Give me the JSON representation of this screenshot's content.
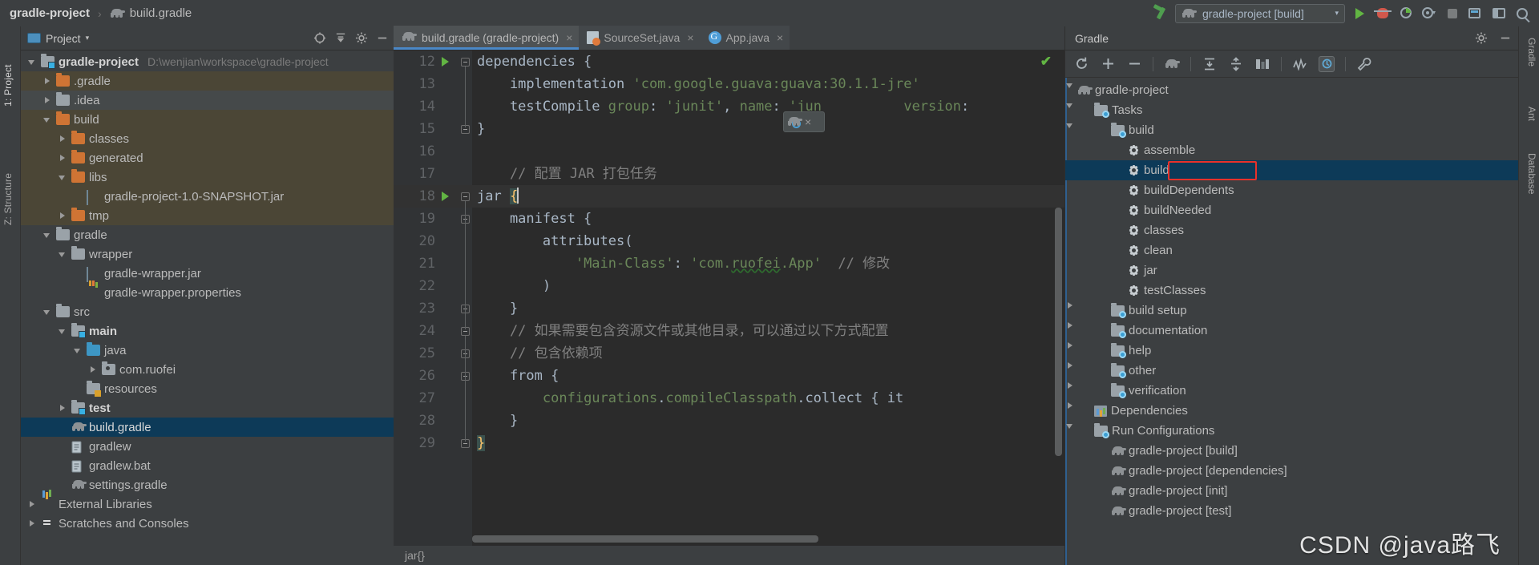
{
  "topbar": {
    "project_name": "gradle-project",
    "separator": "›",
    "file_name": "build.gradle",
    "elephant_icon": "gradle-elephant-icon",
    "hammer_icon": "build-hammer-icon",
    "run_config": {
      "label": "gradle-project [build]",
      "chevron": "▾"
    },
    "actions": [
      {
        "name": "run-button",
        "glyph": "run-triangle-icon"
      },
      {
        "name": "debug-button",
        "glyph": "debug-bug-icon"
      },
      {
        "name": "run-with-coverage-button",
        "glyph": "coverage-icon"
      },
      {
        "name": "profiler-button",
        "glyph": "profiler-icon"
      },
      {
        "name": "stop-button",
        "glyph": "stop-square-icon"
      },
      {
        "name": "update-button",
        "glyph": "update-icon"
      },
      {
        "name": "layout-button",
        "glyph": "layout-icon"
      },
      {
        "name": "search-everywhere-button",
        "glyph": "search-icon"
      }
    ]
  },
  "left_strip": {
    "tabs": [
      {
        "label": "1: Project",
        "selected": true
      },
      {
        "label": "Z: Structure",
        "selected": false
      },
      {
        "label": "",
        "selected": false
      }
    ]
  },
  "right_strip": {
    "tabs": [
      {
        "label": "Gradle"
      },
      {
        "label": "Ant"
      },
      {
        "label": "Database"
      }
    ]
  },
  "project_pane": {
    "title": "Project",
    "caret": "▾",
    "toolbar_icons": [
      "locate-icon",
      "collapse-all-icon",
      "settings-gear-icon",
      "hide-icon"
    ],
    "tree": [
      {
        "depth": 0,
        "arrow": "down",
        "icon": "module-folder",
        "label": "gradle-project",
        "bold": true,
        "path": "D:\\wenjian\\workspace\\gradle-project",
        "row": "normal"
      },
      {
        "depth": 1,
        "arrow": "right",
        "icon": "folder-orange",
        "label": ".gradle",
        "bold": false,
        "path": "",
        "row": "tan"
      },
      {
        "depth": 1,
        "arrow": "right",
        "icon": "folder-gray",
        "label": ".idea",
        "bold": false,
        "path": "",
        "row": "gray"
      },
      {
        "depth": 1,
        "arrow": "down",
        "icon": "folder-orange",
        "label": "build",
        "bold": false,
        "path": "",
        "row": "tan"
      },
      {
        "depth": 2,
        "arrow": "right",
        "icon": "folder-orange",
        "label": "classes",
        "bold": false,
        "path": "",
        "row": "tan"
      },
      {
        "depth": 2,
        "arrow": "right",
        "icon": "folder-orange",
        "label": "generated",
        "bold": false,
        "path": "",
        "row": "tan"
      },
      {
        "depth": 2,
        "arrow": "down",
        "icon": "folder-orange",
        "label": "libs",
        "bold": false,
        "path": "",
        "row": "tan"
      },
      {
        "depth": 3,
        "arrow": "none",
        "icon": "jar-file",
        "label": "gradle-project-1.0-SNAPSHOT.jar",
        "bold": false,
        "path": "",
        "row": "tan"
      },
      {
        "depth": 2,
        "arrow": "right",
        "icon": "folder-orange",
        "label": "tmp",
        "bold": false,
        "path": "",
        "row": "tan"
      },
      {
        "depth": 1,
        "arrow": "down",
        "icon": "folder-gray",
        "label": "gradle",
        "bold": false,
        "path": "",
        "row": "normal"
      },
      {
        "depth": 2,
        "arrow": "down",
        "icon": "folder-gray",
        "label": "wrapper",
        "bold": false,
        "path": "",
        "row": "normal"
      },
      {
        "depth": 3,
        "arrow": "none",
        "icon": "jar-file",
        "label": "gradle-wrapper.jar",
        "bold": false,
        "path": "",
        "row": "normal"
      },
      {
        "depth": 3,
        "arrow": "none",
        "icon": "properties-file",
        "label": "gradle-wrapper.properties",
        "bold": false,
        "path": "",
        "row": "normal"
      },
      {
        "depth": 1,
        "arrow": "down",
        "icon": "folder-gray",
        "label": "src",
        "bold": false,
        "path": "",
        "row": "normal"
      },
      {
        "depth": 2,
        "arrow": "down",
        "icon": "folder-source-root",
        "label": "main",
        "bold": true,
        "path": "",
        "row": "normal"
      },
      {
        "depth": 3,
        "arrow": "down",
        "icon": "folder-blue",
        "label": "java",
        "bold": false,
        "path": "",
        "row": "normal"
      },
      {
        "depth": 4,
        "arrow": "right",
        "icon": "package-icon",
        "label": "com.ruofei",
        "bold": false,
        "path": "",
        "row": "normal"
      },
      {
        "depth": 3,
        "arrow": "none",
        "icon": "folder-resources",
        "label": "resources",
        "bold": false,
        "path": "",
        "row": "normal"
      },
      {
        "depth": 2,
        "arrow": "right",
        "icon": "folder-test-root",
        "label": "test",
        "bold": true,
        "path": "",
        "row": "normal"
      },
      {
        "depth": 2,
        "arrow": "none",
        "icon": "gradle-file",
        "label": "build.gradle",
        "bold": false,
        "path": "",
        "row": "selected"
      },
      {
        "depth": 2,
        "arrow": "none",
        "icon": "text-file",
        "label": "gradlew",
        "bold": false,
        "path": "",
        "row": "normal"
      },
      {
        "depth": 2,
        "arrow": "none",
        "icon": "text-file",
        "label": "gradlew.bat",
        "bold": false,
        "path": "",
        "row": "normal"
      },
      {
        "depth": 2,
        "arrow": "none",
        "icon": "gradle-file",
        "label": "settings.gradle",
        "bold": false,
        "path": "",
        "row": "normal"
      },
      {
        "depth": 0,
        "arrow": "right",
        "icon": "library-icon",
        "label": "External Libraries",
        "bold": false,
        "path": "",
        "row": "normal"
      },
      {
        "depth": 0,
        "arrow": "right",
        "icon": "scratch-icon",
        "label": "Scratches and Consoles",
        "bold": false,
        "path": "",
        "row": "normal"
      }
    ]
  },
  "editor": {
    "tabs": [
      {
        "label": "build.gradle (gradle-project)",
        "icon": "gradle-elephant-icon",
        "active": true,
        "close": "×"
      },
      {
        "label": "SourceSet.java",
        "icon": "java-class-icon",
        "active": false,
        "close": "×"
      },
      {
        "label": "App.java",
        "icon": "groovy-icon",
        "active": false,
        "close": "×"
      }
    ],
    "inspection_status": "✔",
    "floating_widget": {
      "name": "gradle-reimport-widget",
      "close": "×"
    },
    "breadcrumb": "jar{}",
    "lines": [
      {
        "num": "12",
        "run_marker": true,
        "fold": "open",
        "indent": 0,
        "tokens": [
          {
            "t": "dependencies {",
            "c": "fn"
          }
        ]
      },
      {
        "num": "13",
        "run_marker": false,
        "fold": "none",
        "indent": 0,
        "tokens": [
          {
            "t": "    implementation ",
            "c": "fn"
          },
          {
            "t": "'com.google.guava:guava:30.1.1-jre'",
            "c": "str"
          }
        ]
      },
      {
        "num": "14",
        "run_marker": false,
        "fold": "none",
        "indent": 0,
        "tokens": [
          {
            "t": "    testCompile ",
            "c": "fn"
          },
          {
            "t": "group",
            "c": "str"
          },
          {
            "t": ": ",
            "c": "fn"
          },
          {
            "t": "'junit'",
            "c": "str"
          },
          {
            "t": ", ",
            "c": "fn"
          },
          {
            "t": "name",
            "c": "str"
          },
          {
            "t": ": ",
            "c": "fn"
          },
          {
            "t": "'jun",
            "c": "str"
          },
          {
            "t": "          ",
            "c": "fn"
          },
          {
            "t": "version",
            "c": "str"
          },
          {
            "t": ":",
            "c": "fn"
          }
        ]
      },
      {
        "num": "15",
        "run_marker": false,
        "fold": "close",
        "indent": 0,
        "tokens": [
          {
            "t": "}",
            "c": "fn"
          }
        ]
      },
      {
        "num": "16",
        "run_marker": false,
        "fold": "none",
        "indent": 0,
        "tokens": []
      },
      {
        "num": "17",
        "run_marker": false,
        "fold": "none",
        "indent": 0,
        "tokens": [
          {
            "t": "    // 配置 JAR 打包任务",
            "c": "cmt"
          }
        ]
      },
      {
        "num": "18",
        "run_marker": true,
        "fold": "open",
        "indent": 0,
        "tokens": [
          {
            "t": "jar ",
            "c": "fn"
          },
          {
            "t": "{",
            "c": "brace"
          },
          {
            "t": "|",
            "c": "caret"
          }
        ]
      },
      {
        "num": "19",
        "run_marker": false,
        "fold": "open",
        "indent": 0,
        "tokens": [
          {
            "t": "    manifest {",
            "c": "fn"
          }
        ]
      },
      {
        "num": "20",
        "run_marker": false,
        "fold": "none",
        "indent": 0,
        "tokens": [
          {
            "t": "        attributes(",
            "c": "fn"
          }
        ]
      },
      {
        "num": "21",
        "run_marker": false,
        "fold": "none",
        "indent": 0,
        "tokens": [
          {
            "t": "            ",
            "c": "fn"
          },
          {
            "t": "'Main-Class'",
            "c": "str"
          },
          {
            "t": ": ",
            "c": "fn"
          },
          {
            "t": "'com.",
            "c": "str"
          },
          {
            "t": "ruofei",
            "c": "str-wavy"
          },
          {
            "t": ".App'",
            "c": "str"
          },
          {
            "t": "  // 修改",
            "c": "cmt"
          }
        ]
      },
      {
        "num": "22",
        "run_marker": false,
        "fold": "none",
        "indent": 0,
        "tokens": [
          {
            "t": "        )",
            "c": "fn"
          }
        ]
      },
      {
        "num": "23",
        "run_marker": false,
        "fold": "close",
        "indent": 0,
        "tokens": [
          {
            "t": "    }",
            "c": "fn"
          }
        ]
      },
      {
        "num": "24",
        "run_marker": false,
        "fold": "close",
        "indent": 0,
        "tokens": [
          {
            "t": "    // 如果需要包含资源文件或其他目录，可以通过以下方式配置",
            "c": "cmt"
          }
        ]
      },
      {
        "num": "25",
        "run_marker": false,
        "fold": "close",
        "indent": 0,
        "tokens": [
          {
            "t": "    // 包含依赖项",
            "c": "cmt"
          }
        ]
      },
      {
        "num": "26",
        "run_marker": false,
        "fold": "close",
        "indent": 0,
        "tokens": [
          {
            "t": "    from {",
            "c": "fn"
          }
        ]
      },
      {
        "num": "27",
        "run_marker": false,
        "fold": "none",
        "indent": 0,
        "tokens": [
          {
            "t": "        ",
            "c": "fn"
          },
          {
            "t": "configurations",
            "c": "str"
          },
          {
            "t": ".",
            "c": "fn"
          },
          {
            "t": "compileClasspath",
            "c": "str"
          },
          {
            "t": ".collect { it",
            "c": "fn"
          }
        ]
      },
      {
        "num": "28",
        "run_marker": false,
        "fold": "none",
        "indent": 0,
        "tokens": [
          {
            "t": "    }",
            "c": "fn"
          }
        ]
      },
      {
        "num": "29",
        "run_marker": false,
        "fold": "close",
        "indent": 0,
        "tokens": [
          {
            "t": "}",
            "c": "brace"
          }
        ]
      }
    ]
  },
  "gradle_pane": {
    "title": "Gradle",
    "header_icons": [
      "settings-gear-icon",
      "hide-icon"
    ],
    "toolbar": [
      {
        "name": "refresh-all-button",
        "glyph": "refresh-icon"
      },
      {
        "name": "link-gradle-project-button",
        "glyph": "plus-icon"
      },
      {
        "name": "detach-project-button",
        "glyph": "minus-icon"
      },
      {
        "name": "execute-gradle-task-button",
        "glyph": "gradle-elephant-icon"
      },
      {
        "name": "expand-all-button",
        "glyph": "expand-all-icon"
      },
      {
        "name": "collapse-all-button",
        "glyph": "collapse-all-icon"
      },
      {
        "name": "group-tasks-button",
        "glyph": "group-modules-icon"
      },
      {
        "name": "toggle-offline-button",
        "glyph": "offline-icon"
      },
      {
        "name": "show-task-list-button",
        "glyph": "task-list-icon"
      },
      {
        "name": "build-tool-settings-button",
        "glyph": "wrench-icon"
      }
    ],
    "tree": [
      {
        "depth": 0,
        "arrow": "down",
        "icon": "gradle-elephant-icon",
        "label": "gradle-project",
        "selected": false
      },
      {
        "depth": 1,
        "arrow": "down",
        "icon": "task-folder-icon",
        "label": "Tasks",
        "selected": false
      },
      {
        "depth": 2,
        "arrow": "down",
        "icon": "task-folder-icon",
        "label": "build",
        "selected": false
      },
      {
        "depth": 3,
        "arrow": "none",
        "icon": "gear-icon",
        "label": "assemble",
        "selected": false
      },
      {
        "depth": 3,
        "arrow": "none",
        "icon": "gear-icon",
        "label": "build",
        "selected": true
      },
      {
        "depth": 3,
        "arrow": "none",
        "icon": "gear-icon",
        "label": "buildDependents",
        "selected": false
      },
      {
        "depth": 3,
        "arrow": "none",
        "icon": "gear-icon",
        "label": "buildNeeded",
        "selected": false
      },
      {
        "depth": 3,
        "arrow": "none",
        "icon": "gear-icon",
        "label": "classes",
        "selected": false
      },
      {
        "depth": 3,
        "arrow": "none",
        "icon": "gear-icon",
        "label": "clean",
        "selected": false
      },
      {
        "depth": 3,
        "arrow": "none",
        "icon": "gear-icon",
        "label": "jar",
        "selected": false
      },
      {
        "depth": 3,
        "arrow": "none",
        "icon": "gear-icon",
        "label": "testClasses",
        "selected": false
      },
      {
        "depth": 2,
        "arrow": "right",
        "icon": "task-folder-icon",
        "label": "build setup",
        "selected": false
      },
      {
        "depth": 2,
        "arrow": "right",
        "icon": "task-folder-icon",
        "label": "documentation",
        "selected": false
      },
      {
        "depth": 2,
        "arrow": "right",
        "icon": "task-folder-icon",
        "label": "help",
        "selected": false
      },
      {
        "depth": 2,
        "arrow": "right",
        "icon": "task-folder-icon",
        "label": "other",
        "selected": false
      },
      {
        "depth": 2,
        "arrow": "right",
        "icon": "task-folder-icon",
        "label": "verification",
        "selected": false
      },
      {
        "depth": 1,
        "arrow": "right",
        "icon": "dependencies-icon",
        "label": "Dependencies",
        "selected": false
      },
      {
        "depth": 1,
        "arrow": "down",
        "icon": "task-folder-icon",
        "label": "Run Configurations",
        "selected": false
      },
      {
        "depth": 2,
        "arrow": "none",
        "icon": "gradle-elephant-icon",
        "label": "gradle-project [build]",
        "selected": false
      },
      {
        "depth": 2,
        "arrow": "none",
        "icon": "gradle-elephant-icon",
        "label": "gradle-project [dependencies]",
        "selected": false
      },
      {
        "depth": 2,
        "arrow": "none",
        "icon": "gradle-elephant-icon",
        "label": "gradle-project [init]",
        "selected": false
      },
      {
        "depth": 2,
        "arrow": "none",
        "icon": "gradle-elephant-icon",
        "label": "gradle-project [test]",
        "selected": false
      }
    ]
  },
  "watermark": "CSDN @java路飞"
}
